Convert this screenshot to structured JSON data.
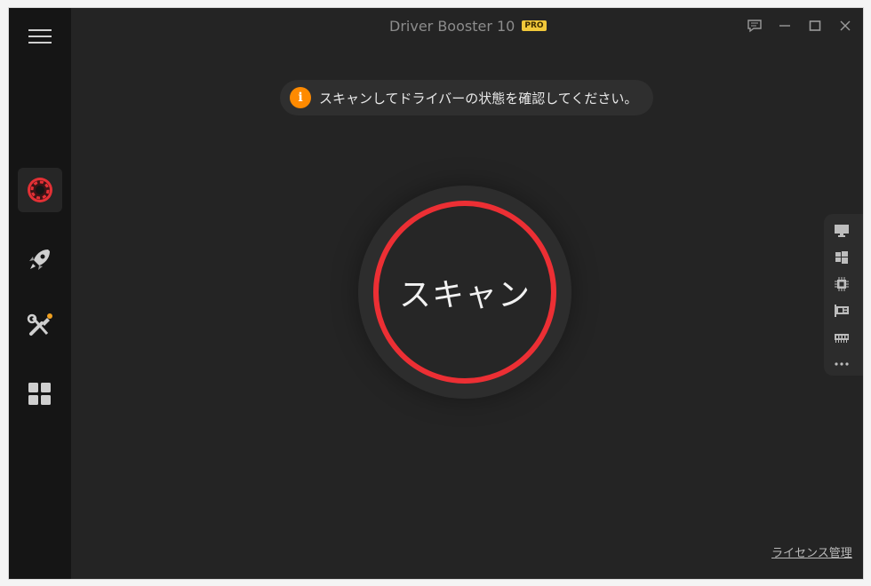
{
  "app": {
    "title": "Driver Booster 10",
    "badge": "PRO"
  },
  "window_controls": [
    "feedback-icon",
    "minimize-icon",
    "maximize-icon",
    "close-icon"
  ],
  "sidebar": {
    "items": [
      {
        "name": "scan",
        "icon": "lifebuoy-icon",
        "active": true
      },
      {
        "name": "boost",
        "icon": "rocket-icon",
        "active": false
      },
      {
        "name": "tools",
        "icon": "tools-icon",
        "active": false,
        "notification": true
      },
      {
        "name": "action-center",
        "icon": "grid-icon",
        "active": false
      }
    ]
  },
  "banner": {
    "icon": "i",
    "text": "スキャンしてドライバーの状態を確認してください。"
  },
  "scan": {
    "label": "スキャン"
  },
  "hardware_panel": {
    "icons": [
      "monitor-icon",
      "windows-icon",
      "cpu-icon",
      "graphics-card-icon",
      "memory-icon",
      "more-icon"
    ]
  },
  "footer": {
    "license_link": "ライセンス管理"
  },
  "colors": {
    "accent_red": "#ec2f34",
    "info_orange": "#ff8a00",
    "background": "#242424",
    "sidebar": "#151515"
  }
}
